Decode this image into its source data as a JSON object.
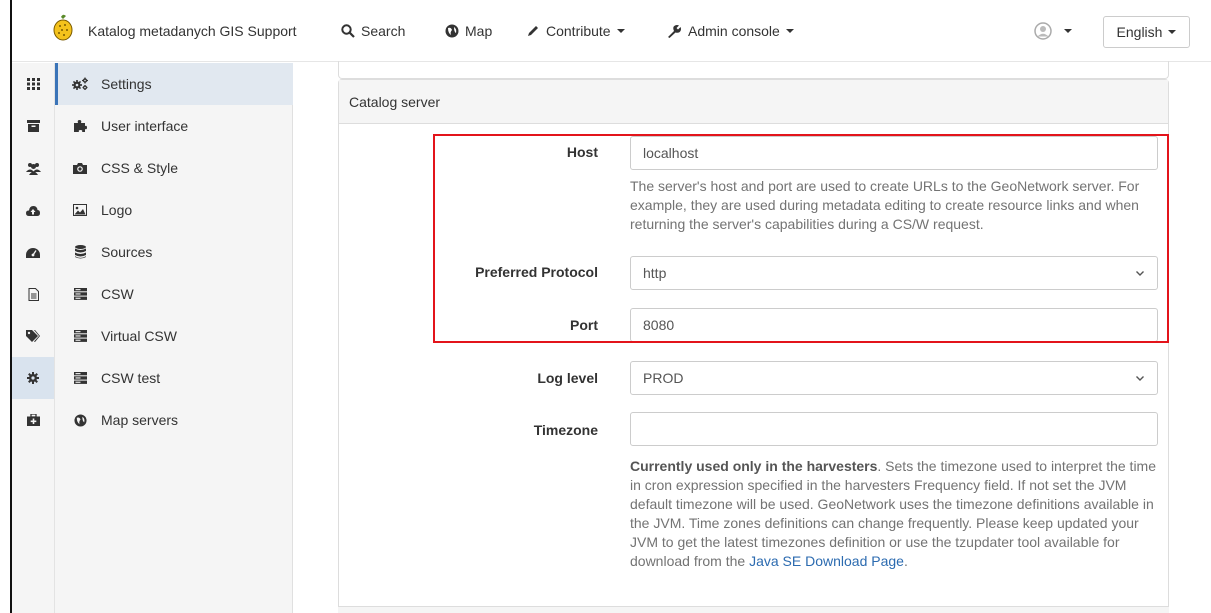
{
  "navbar": {
    "catalog_title": "Katalog metadanych GIS Support",
    "search_label": "Search",
    "map_label": "Map",
    "contribute_label": "Contribute",
    "admin_label": "Admin console",
    "language_label": "English"
  },
  "rail": {
    "icons": [
      "grid-icon",
      "archive-icon",
      "users-icon",
      "cloud-upload-icon",
      "dashboard-icon",
      "file-text-icon",
      "tags-icon",
      "cog-icon",
      "medkit-icon"
    ],
    "active_index": 7
  },
  "menu": {
    "items": [
      {
        "label": "Settings",
        "icon": "cogs-icon"
      },
      {
        "label": "User interface",
        "icon": "puzzle-icon"
      },
      {
        "label": "CSS & Style",
        "icon": "camera-icon"
      },
      {
        "label": "Logo",
        "icon": "image-icon"
      },
      {
        "label": "Sources",
        "icon": "database-icon"
      },
      {
        "label": "CSW",
        "icon": "server-icon"
      },
      {
        "label": "Virtual CSW",
        "icon": "server-icon"
      },
      {
        "label": "CSW test",
        "icon": "server-icon"
      },
      {
        "label": "Map servers",
        "icon": "globe-icon"
      }
    ],
    "active_index": 0
  },
  "panel": {
    "heading": "Catalog server",
    "host": {
      "label": "Host",
      "value": "localhost",
      "help": "The server's host and port are used to create URLs to the GeoNetwork server. For example, they are used during metadata editing to create resource links and when returning the server's capabilities during a CS/W request."
    },
    "protocol": {
      "label": "Preferred Protocol",
      "value": "http"
    },
    "port": {
      "label": "Port",
      "value": "8080"
    },
    "log_level": {
      "label": "Log level",
      "value": "PROD"
    },
    "timezone": {
      "label": "Timezone",
      "value": "",
      "help_bold": "Currently used only in the harvesters",
      "help": ". Sets the timezone used to interpret the time in cron expression specified in the harvesters Frequency field. If not set the JVM default timezone will be used. GeoNetwork uses the timezone definitions available in the JVM. Time zones definitions can change frequently. Please keep updated your JVM to get the latest timezones definition or use the tzupdater tool available for download from the ",
      "help_link": "Java SE Download Page",
      "help_end": "."
    }
  },
  "colors": {
    "highlight": "#e3141b",
    "link": "#2c6bb0",
    "active_menu": "#e1e8f0"
  }
}
